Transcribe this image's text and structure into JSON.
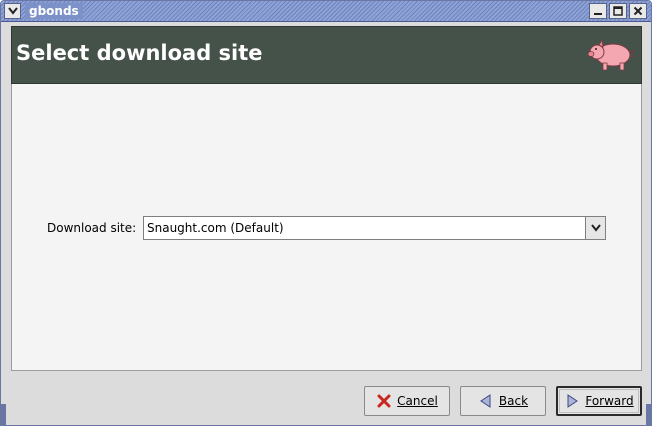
{
  "window": {
    "title": "gbonds",
    "menu_icon": "chevron-down-icon",
    "minimize_icon": "minimize-icon",
    "maximize_icon": "maximize-icon",
    "close_icon": "close-icon"
  },
  "header": {
    "title": "Select download site",
    "logo_icon": "pig-icon"
  },
  "form": {
    "download_site_label": "Download site:",
    "download_site_value": "Snaught.com (Default)"
  },
  "buttons": {
    "cancel_label": "Cancel",
    "back_label": "Back",
    "forward_label": "Forward"
  },
  "colors": {
    "header_bg": "#45524a",
    "titlebar": "#7c91c8"
  }
}
